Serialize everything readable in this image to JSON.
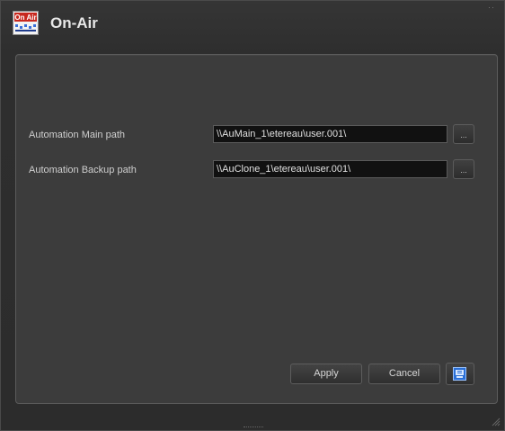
{
  "window": {
    "title": "On-Air",
    "icon": "on-air-logo-icon",
    "icon_text": "On Air"
  },
  "form": {
    "main_path": {
      "label": "Automation Main path",
      "value": "\\\\AuMain_1\\etereau\\user.001\\",
      "browse_label": "..."
    },
    "backup_path": {
      "label": "Automation Backup path",
      "value": "\\\\AuClone_1\\etereau\\user.001\\",
      "browse_label": "..."
    }
  },
  "footer": {
    "apply_label": "Apply",
    "cancel_label": "Cancel",
    "help_icon": "help-icon"
  },
  "colors": {
    "background": "#2b2b2b",
    "panel": "#3c3c3c",
    "field": "#111111",
    "text": "#d0d0d0",
    "icon_red": "#c8281e",
    "icon_blue": "#3a6fd8"
  }
}
